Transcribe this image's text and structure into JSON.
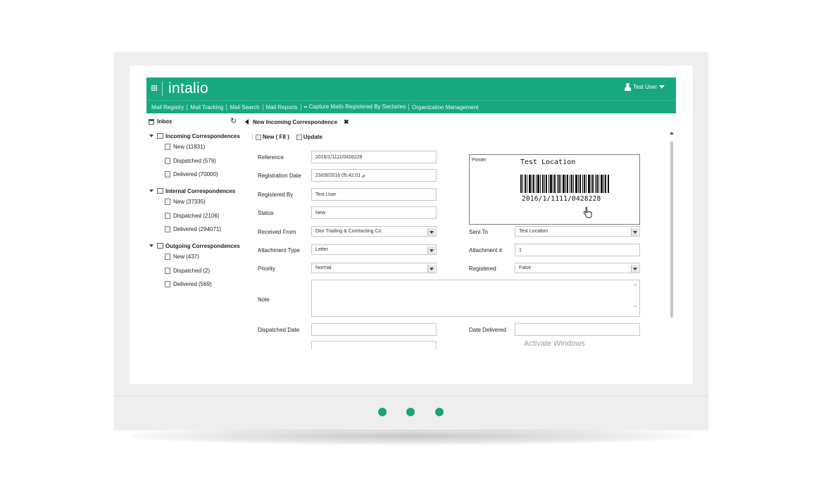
{
  "header": {
    "logo": "intalio",
    "user": "Test User"
  },
  "menu": [
    "Mail Registry",
    "Mail Tracking",
    "Mail Search",
    "Mail Reports",
    "Capture Mails Registered By Sectaries",
    "Organization Management"
  ],
  "sidebar": {
    "inbox_label": "Inbox",
    "groups": [
      {
        "title": "Incoming Correspondences",
        "items": [
          "New (11831)",
          "Dispatched (579)",
          "Delivered (70000)"
        ]
      },
      {
        "title": "Internal Correspondences",
        "items": [
          "New (37335)",
          "Dispatched (2106)",
          "Delivered (294071)"
        ]
      },
      {
        "title": "Outgoing Correspondences",
        "items": [
          "New (437)",
          "Dispatched (2)",
          "Delivered (569)"
        ]
      }
    ]
  },
  "tab": {
    "title": "New Incoming Correspondence"
  },
  "toolbar": {
    "new_label": "New ( F8 )",
    "update_label": "Update"
  },
  "form": {
    "reference_label": "Reference",
    "reference_value": "2016/1/1111/0428228",
    "registration_date_label": "Registration Date",
    "registration_date_value": "23/09/2016 05:42:01 م",
    "registered_by_label": "Registered By",
    "registered_by_value": "Test User",
    "status_label": "Status",
    "status_value": "New",
    "received_from_label": "Received From",
    "received_from_value": "Dior Trading & Contracting Co.",
    "sent_to_label": "Sent To",
    "sent_to_value": "Test Location",
    "attachment_type_label": "Attachment Type",
    "attachment_type_value": "Letter",
    "attachment_num_label": "Attachment #",
    "attachment_num_value": "1",
    "priority_label": "Priority",
    "priority_value": "Normal",
    "registered_label": "Registered",
    "registered_value": "False",
    "note_label": "Note",
    "dispatched_date_label": "Dispatched Date",
    "date_delivered_label": "Date Delivered"
  },
  "printer": {
    "label": "Printer",
    "location": "Test Location",
    "barcode_text": "2016/1/1111/0428228"
  },
  "watermark": "Activate Windows",
  "colors": {
    "brand": "#17a880",
    "accent_dots": "#1aa37a"
  }
}
